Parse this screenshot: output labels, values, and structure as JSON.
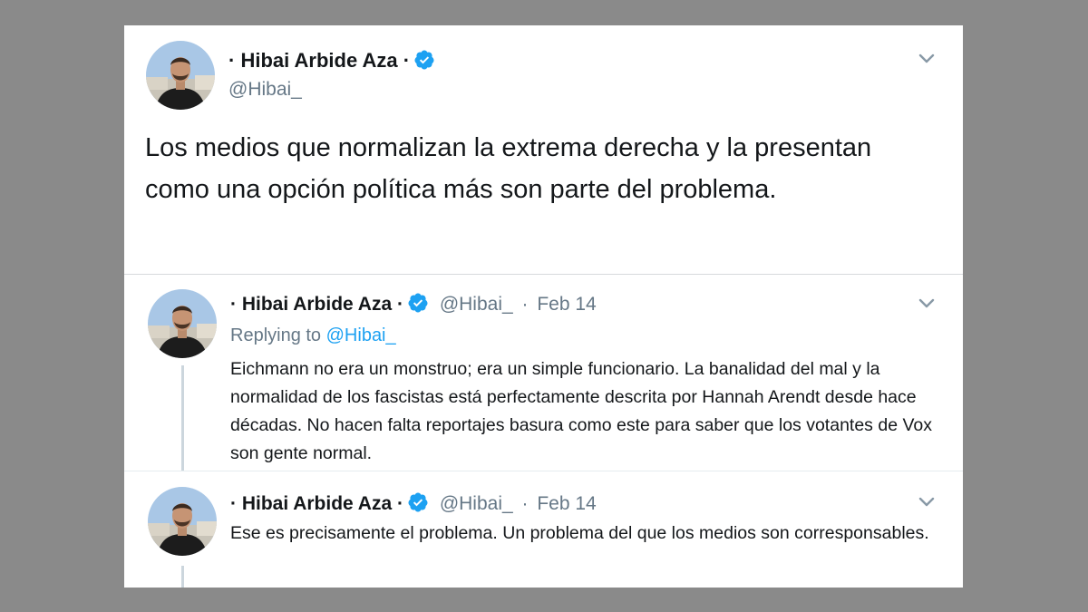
{
  "main_tweet": {
    "author_name": "· Hibai Arbide Aza ·",
    "handle": "@Hibai_",
    "text": "Los medios que normalizan la extrema derecha y la presentan como una opción política más son parte del problema."
  },
  "replies": [
    {
      "author_name": "· Hibai Arbide Aza ·",
      "handle": "@Hibai_",
      "separator": "·",
      "date": "Feb 14",
      "replying_prefix": "Replying to",
      "replying_to": "@Hibai_",
      "text": "Eichmann no era un monstruo; era un simple funcionario. La banalidad del mal y la normalidad de los fascistas está perfectamente descrita por Hannah Arendt desde hace décadas. No hacen falta reportajes basura como este para saber que los votantes de Vox son gente normal."
    },
    {
      "author_name": "· Hibai Arbide Aza ·",
      "handle": "@Hibai_",
      "separator": "·",
      "date": "Feb 14",
      "text": "Ese es precisamente el problema. Un problema del que los medios son corresponsables."
    }
  ],
  "icons": {
    "verified": "verified-badge-icon",
    "menu": "chevron-down-icon"
  },
  "colors": {
    "accent": "#1da1f2",
    "text_primary": "#14171a",
    "text_secondary": "#657786",
    "page_background": "#8a8a8a"
  }
}
